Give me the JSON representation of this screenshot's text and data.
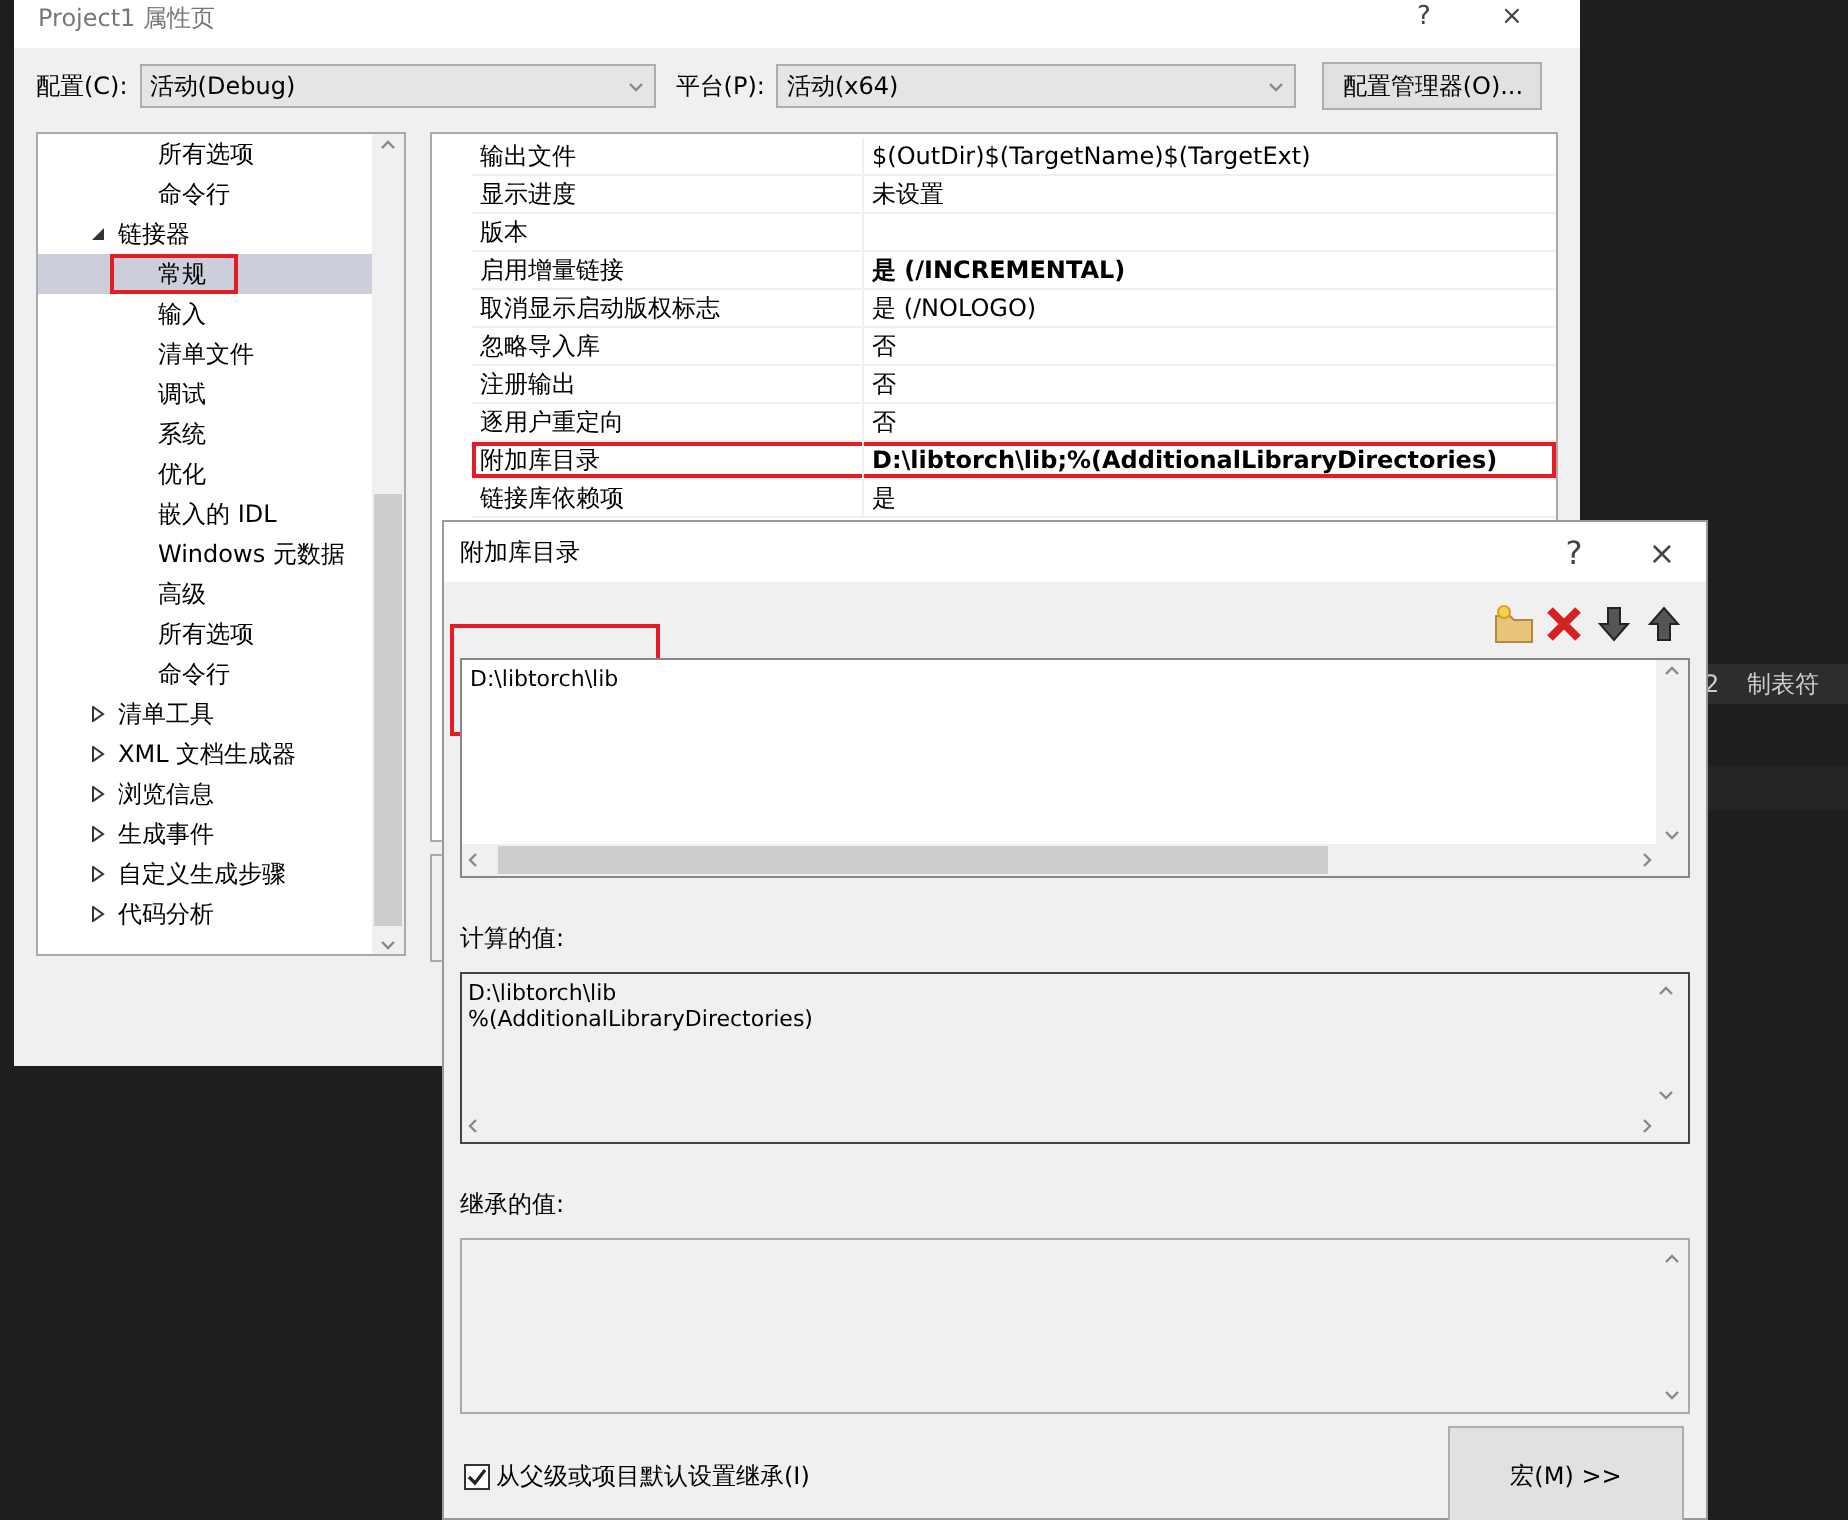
{
  "editor_status": {
    "texts": [
      "2",
      "制表符"
    ]
  },
  "property_window": {
    "title": "Project1 属性页",
    "title_buttons": [
      "?",
      "×"
    ],
    "config_label": "配置(C):",
    "config_value": "活动(Debug)",
    "platform_label": "平台(P):",
    "platform_value": "活动(x64)",
    "manager_button": "配置管理器(O)...",
    "tree": [
      {
        "children": [
          {
            "label": "所有选项",
            "selected": false,
            "annotated": false
          },
          {
            "label": "命令行",
            "selected": false,
            "annotated": false
          }
        ]
      },
      {
        "label": "链接器",
        "expanded": true,
        "selected": false,
        "annotated": false,
        "children": [
          {
            "label": "常规",
            "selected": true,
            "annotated": true
          },
          {
            "label": "输入",
            "selected": false,
            "annotated": false
          },
          {
            "label": "清单文件",
            "selected": false,
            "annotated": false
          },
          {
            "label": "调试",
            "selected": false,
            "annotated": false
          },
          {
            "label": "系统",
            "selected": false,
            "annotated": false
          },
          {
            "label": "优化",
            "selected": false,
            "annotated": false
          },
          {
            "label": "嵌入的 IDL",
            "selected": false,
            "annotated": false
          },
          {
            "label": "Windows 元数据",
            "selected": false,
            "annotated": false
          },
          {
            "label": "高级",
            "selected": false,
            "annotated": false
          },
          {
            "label": "所有选项",
            "selected": false,
            "annotated": false
          },
          {
            "label": "命令行",
            "selected": false,
            "annotated": false
          }
        ]
      },
      {
        "label": "清单工具",
        "expanded": false,
        "selected": false,
        "annotated": false
      },
      {
        "label": "XML 文档生成器",
        "expanded": false,
        "selected": false,
        "annotated": false
      },
      {
        "label": "浏览信息",
        "expanded": false,
        "selected": false,
        "annotated": false
      },
      {
        "label": "生成事件",
        "expanded": false,
        "selected": false,
        "annotated": false
      },
      {
        "label": "自定义生成步骤",
        "expanded": false,
        "selected": false,
        "annotated": false
      },
      {
        "label": "代码分析",
        "expanded": false,
        "selected": false,
        "annotated": false
      }
    ],
    "properties": [
      {
        "name": "输出文件",
        "value": "$(OutDir)$(TargetName)$(TargetExt)",
        "bold": false,
        "annotated": false
      },
      {
        "name": "显示进度",
        "value": "未设置",
        "bold": false,
        "annotated": false
      },
      {
        "name": "版本",
        "annotated": false
      },
      {
        "name": "启用增量链接",
        "value": "是 (/INCREMENTAL)",
        "bold": true,
        "annotated": false
      },
      {
        "name": "取消显示启动版权标志",
        "value": "是 (/NOLOGO)",
        "bold": false,
        "annotated": false
      },
      {
        "name": "忽略导入库",
        "value": "否",
        "bold": false,
        "annotated": false
      },
      {
        "name": "注册输出",
        "value": "否",
        "bold": false,
        "annotated": false
      },
      {
        "name": "逐用户重定向",
        "value": "否",
        "bold": false,
        "annotated": false
      },
      {
        "name": "附加库目录",
        "value": "D:\\libtorch\\lib;%(AdditionalLibraryDirectories)",
        "bold": true,
        "annotated": true
      },
      {
        "name": "链接库依赖项",
        "value": "是",
        "bold": false,
        "annotated": false
      }
    ]
  },
  "dialog": {
    "title": "附加库目录",
    "title_buttons": [
      "?",
      "×"
    ],
    "directories": [
      {
        "text": "D:\\libtorch\\lib",
        "annotated": true
      }
    ],
    "computed_label": "计算的值:",
    "computed_lines": [
      "D:\\libtorch\\lib",
      "%(AdditionalLibraryDirectories)"
    ],
    "inherited_label": "继承的值:",
    "inherit_checkbox": {
      "label": "从父级或项目默认设置继承(I)",
      "checked": true
    },
    "macros_button": "宏(M) >>"
  }
}
